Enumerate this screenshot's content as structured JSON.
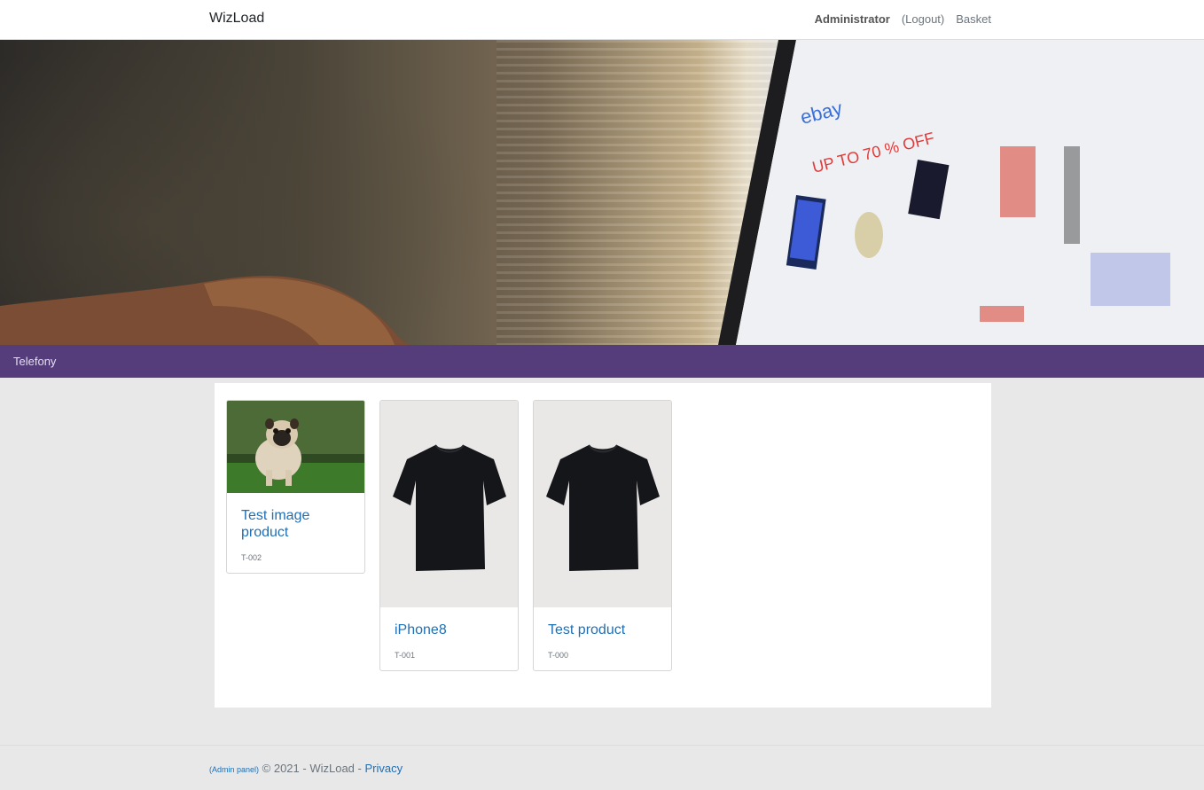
{
  "header": {
    "brand": "WizLoad",
    "user": "Administrator",
    "logout": "(Logout)",
    "basket": "Basket"
  },
  "category_bar": {
    "active_category": "Telefony"
  },
  "products": [
    {
      "title": "Test image product",
      "sku": "T-002",
      "image": "pug-photo"
    },
    {
      "title": "iPhone8",
      "sku": "T-001",
      "image": "black-tshirt-photo"
    },
    {
      "title": "Test product",
      "sku": "T-000",
      "image": "black-tshirt-photo"
    }
  ],
  "footer": {
    "admin_panel": "(Admin panel)",
    "copyright": "© 2021 - WizLoad -",
    "privacy": "Privacy"
  },
  "colors": {
    "category_bar": "#553c7b",
    "link": "#1f6fb5"
  }
}
